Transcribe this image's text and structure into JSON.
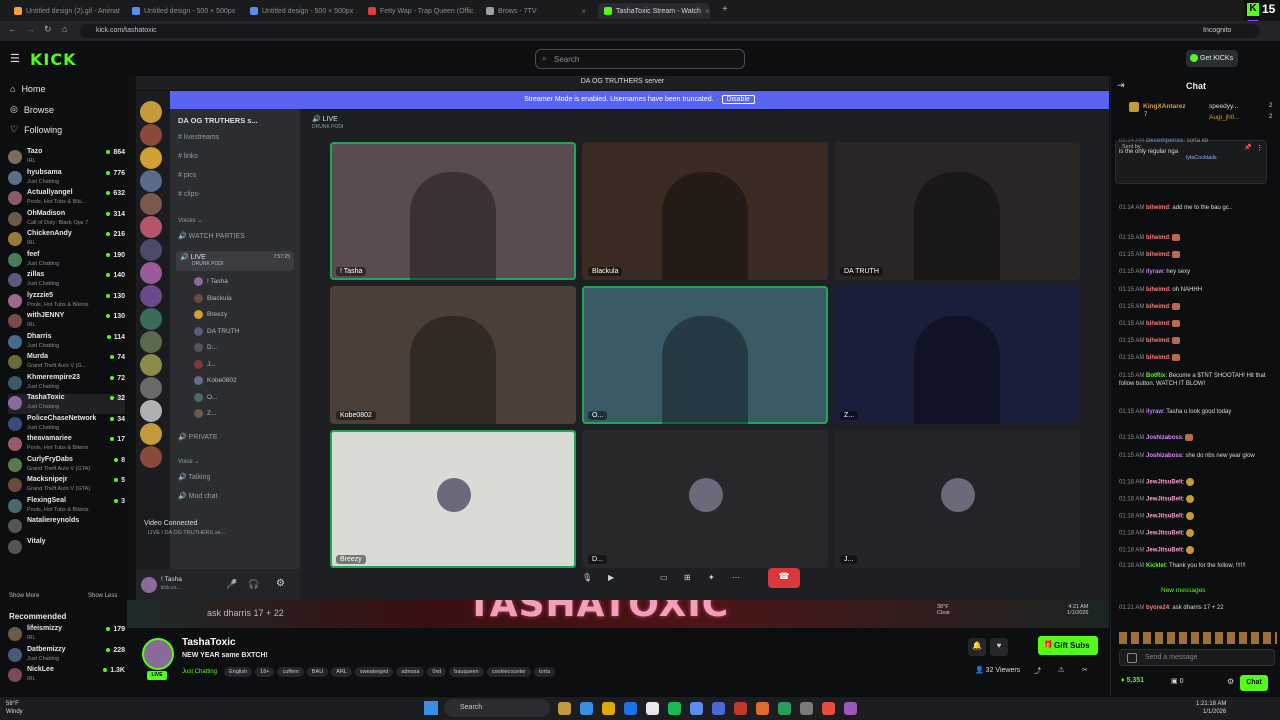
{
  "tabs": [
    {
      "label": "Untitled design (2).gif - Animat",
      "color": "#f2a33b"
    },
    {
      "label": "Untitled design - 500 × 500px",
      "color": "#5b8def"
    },
    {
      "label": "Untitled design - 500 × 500px",
      "color": "#5b8def"
    },
    {
      "label": "Fetty Wap - Trap Queen (Offic",
      "color": "#e53935"
    },
    {
      "label": "Brows - 7TV",
      "color": "#9aa0a6"
    },
    {
      "label": "TashaToxic Stream - Watch",
      "color": "#53fc18"
    }
  ],
  "address": {
    "url": "kick.com/tashatoxic",
    "incognito": "Incognito"
  },
  "overlay": {
    "counter": "15"
  },
  "header": {
    "logo": "KICK",
    "search_placeholder": "Search",
    "get_kicks": "Get KICKs"
  },
  "nav": {
    "home": "Home",
    "browse": "Browse",
    "following": "Following"
  },
  "following": [
    {
      "name": "Tazo",
      "cat": "IRL",
      "viewers": "864",
      "color": "#7a6b5a"
    },
    {
      "name": "hyubsama",
      "cat": "Just Chatting",
      "viewers": "776",
      "color": "#5a6f8a"
    },
    {
      "name": "Actuallyangel",
      "cat": "Pools, Hot Tubs & Biki...",
      "viewers": "632",
      "color": "#8a5a6a"
    },
    {
      "name": "OhMadison",
      "cat": "Call of Duty: Black Ops 7",
      "viewers": "314",
      "color": "#6a5a4a"
    },
    {
      "name": "ChickenAndy",
      "cat": "IRL",
      "viewers": "216",
      "color": "#9a7a3a"
    },
    {
      "name": "feef",
      "cat": "Just Chatting",
      "viewers": "190",
      "color": "#4a7a5a"
    },
    {
      "name": "zillas",
      "cat": "Just Chatting",
      "viewers": "140",
      "color": "#5a5a7a"
    },
    {
      "name": "lyzzzie5",
      "cat": "Pools, Hot Tubs & Bikinis",
      "viewers": "130",
      "color": "#9a6a8a"
    },
    {
      "name": "withJENNY",
      "cat": "IRL",
      "viewers": "130",
      "color": "#7a4a4a"
    },
    {
      "name": "Dharris",
      "cat": "Just Chatting",
      "viewers": "114",
      "color": "#4a6a8a"
    },
    {
      "name": "Murda",
      "cat": "Grand Theft Auto V (G...",
      "viewers": "74",
      "color": "#6a6a3a"
    },
    {
      "name": "Khmerempire23",
      "cat": "Just Chatting",
      "viewers": "72",
      "color": "#3a5a6a"
    },
    {
      "name": "TashaToxic",
      "cat": "Just Chatting",
      "viewers": "32",
      "color": "#8a6a9a"
    },
    {
      "name": "PoliceChaseNetwork",
      "cat": "Just Chatting",
      "viewers": "34",
      "color": "#3a4a7a"
    },
    {
      "name": "theavamariee",
      "cat": "Pools, Hot Tubs & Bikinis",
      "viewers": "17",
      "color": "#9a5a6a"
    },
    {
      "name": "CurlyFryDabs",
      "cat": "Grand Theft Auto V (GTA)",
      "viewers": "8",
      "color": "#5a7a4a"
    },
    {
      "name": "Macksnipejr",
      "cat": "Grand Theft Auto V (GTA)",
      "viewers": "5",
      "color": "#6a4a3a"
    },
    {
      "name": "FlexingSeal",
      "cat": "Pools, Hot Tubs & Bikinis",
      "viewers": "3",
      "color": "#4a6a6a"
    },
    {
      "name": "Nataliereynolds",
      "cat": "",
      "viewers": "",
      "color": "#555"
    },
    {
      "name": "Vitaly",
      "cat": "",
      "viewers": "",
      "color": "#555"
    }
  ],
  "show_more": "Show More",
  "show_less": "Show Less",
  "recommended": "Recommended",
  "recommended_list": [
    {
      "name": "lifeismizzy",
      "cat": "IRL",
      "viewers": "179",
      "color": "#6a5a4a"
    },
    {
      "name": "Datbemizzy",
      "cat": "Just Chatting",
      "viewers": "228",
      "color": "#4a5a7a"
    },
    {
      "name": "NickLee",
      "cat": "IRL",
      "viewers": "1.3K",
      "color": "#7a4a5a"
    }
  ],
  "discord": {
    "window_title": "DA OG TRUTHERS server",
    "streamer_mode": "Streamer Mode is enabled. Usernames have been truncated.",
    "disable": "Disable",
    "server": "DA OG TRUTHERS s...",
    "channels": [
      "livestreams",
      "links",
      "pics",
      "clips-"
    ],
    "voices": "Voices",
    "watch_parties": "WATCH PARTIES",
    "live": "LIVE",
    "live_time": "7:57:25",
    "drunk": "DRUNK PODI",
    "voice_users": [
      "! Tasha",
      "Blackula",
      "Breezy",
      "DA TRUTH",
      "D...",
      "J...",
      "Kobe0802",
      "O...",
      "Z..."
    ],
    "private": "PRIVATE",
    "voice": "Voice",
    "talking": "Talking",
    "mod_chat": "Mod chat",
    "video_connected": "Video Connected",
    "vc_sub": "LIVE / DA OG TRUTHERS se...",
    "user": "! Tasha",
    "user_sub": "kick.co...",
    "stage_title": "LIVE",
    "stage_sub": "DRUNK PODI"
  },
  "tiles": [
    {
      "name": "! Tasha",
      "bg": "#5a4a52"
    },
    {
      "name": "Blackula",
      "bg": "#3a2a22"
    },
    {
      "name": "DA TRUTH",
      "bg": "#2a2626"
    },
    {
      "name": "Kobe0802",
      "bg": "#4a4038"
    },
    {
      "name": "O...",
      "bg": "#3a5a66"
    },
    {
      "name": "Z...",
      "bg": "#1a1e3a"
    },
    {
      "name": "Breezy",
      "bg": "#d9dbd5"
    },
    {
      "name": "D...",
      "bg": "#26282a"
    },
    {
      "name": "J...",
      "bg": "#222427"
    }
  ],
  "banner": "TASHATOXIC",
  "inner_taskbar": {
    "weather": "38°F",
    "weather_sub": "Clear",
    "time": "4:21 AM",
    "date": "1/1/2026",
    "ticker": "ask dharris 17 + 22"
  },
  "info": {
    "name": "TashaToxic",
    "title": "NEW YEAR same BXTCH!",
    "category": "Just Chatting",
    "tags": [
      "English",
      "18+",
      "cuffem",
      "BAU",
      "ARL",
      "sweaterged",
      "adnosa",
      "0xd",
      "bauqueen",
      "cookiecounter",
      "torta"
    ],
    "viewers": "32 Viewers",
    "gift": "Gift Subs",
    "live": "LIVE"
  },
  "chat": {
    "title": "Chat",
    "pinned_user": "KingXAntarez",
    "pinned2": "speedyy...",
    "pinned3": "Augi_jh0...",
    "pinned_n1": "2",
    "pinned_n2": "2",
    "pinned_n3": "7",
    "sent_by": "Sent by",
    "sent_user": "lylaCocktails",
    "messages": [
      {
        "t": "01:14 AM",
        "u": "Decemperiss",
        "c": "#8fb3ff",
        "m": "sorta kb"
      },
      {
        "t": "",
        "u": "",
        "c": "#fff",
        "m": "is the only regular nga"
      },
      {
        "t": "01:14 AM",
        "u": "biheimd",
        "c": "#ff7a7a",
        "m": "add me to the bau gc.."
      },
      {
        "t": "01:15 AM",
        "u": "biheimd",
        "c": "#ff7a7a",
        "m": "[emote]"
      },
      {
        "t": "01:15 AM",
        "u": "biheimd",
        "c": "#ff7a7a",
        "m": "[emote]"
      },
      {
        "t": "01:15 AM",
        "u": "ilyraw",
        "c": "#c77dff",
        "m": "hey sexy"
      },
      {
        "t": "01:15 AM",
        "u": "biheimd",
        "c": "#ff7a7a",
        "m": "oh NAHHH"
      },
      {
        "t": "01:15 AM",
        "u": "biheimd",
        "c": "#ff7a7a",
        "m": "[emote]"
      },
      {
        "t": "01:15 AM",
        "u": "biheimd",
        "c": "#ff7a7a",
        "m": "[emote]"
      },
      {
        "t": "01:15 AM",
        "u": "biheimd",
        "c": "#ff7a7a",
        "m": "[emote]"
      },
      {
        "t": "01:15 AM",
        "u": "biheimd",
        "c": "#ff7a7a",
        "m": "[emote]"
      },
      {
        "t": "01:15 AM",
        "u": "BotRix",
        "c": "#53fc18",
        "m": "Become a $TNT SHOOTAH! Hit that follow button. WATCH IT BLOW!"
      },
      {
        "t": "01:15 AM",
        "u": "ilyraw",
        "c": "#c77dff",
        "m": "Tasha u look good today"
      },
      {
        "t": "01:15 AM",
        "u": "Joshizaboss",
        "c": "#d98aff",
        "m": "[emote]"
      },
      {
        "t": "01:15 AM",
        "u": "Joshizaboss",
        "c": "#d98aff",
        "m": "she do nbs new year glow"
      },
      {
        "t": "01:18 AM",
        "u": "JewJitsuBelt",
        "c": "#ff9ad5",
        "m": "[gold]"
      },
      {
        "t": "01:18 AM",
        "u": "JewJitsuBelt",
        "c": "#ff9ad5",
        "m": "[gold]"
      },
      {
        "t": "01:18 AM",
        "u": "JewJitsuBelt",
        "c": "#ff9ad5",
        "m": "[gold]"
      },
      {
        "t": "01:18 AM",
        "u": "JewJitsuBelt",
        "c": "#ff9ad5",
        "m": "[gold]"
      },
      {
        "t": "01:18 AM",
        "u": "JewJitsuBelt",
        "c": "#ff9ad5",
        "m": "[gold]"
      },
      {
        "t": "01:18 AM",
        "u": "Kicklet",
        "c": "#53fc18",
        "m": "Thank you for the follow, !!!!!!"
      }
    ],
    "new_messages": "New messages",
    "last": {
      "t": "01:21 AM",
      "u": "byore24",
      "c": "#ff7a7a",
      "m": "ask dharris 17 + 22"
    },
    "placeholder": "Send a message",
    "points": "5,351",
    "zero": "0",
    "chat_btn": "Chat"
  },
  "taskbar": {
    "temp": "58°F",
    "weather": "Windy",
    "search": "Search",
    "time": "1:21:18 AM",
    "date": "1/1/2026"
  }
}
